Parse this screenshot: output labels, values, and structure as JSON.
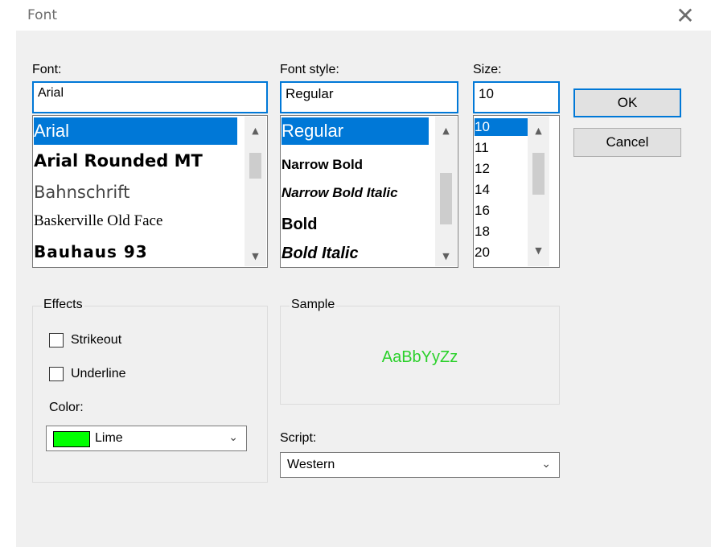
{
  "window": {
    "title": "Font",
    "close_glyph": "✕"
  },
  "font": {
    "label": "Font:",
    "value": "Arial",
    "items": [
      "Arial",
      "Arial Rounded MT",
      "Bahnschrift",
      "Baskerville Old Face",
      "Bauhaus 93"
    ]
  },
  "style": {
    "label": "Font style:",
    "value": "Regular",
    "items": [
      "Regular",
      "Narrow Bold",
      "Narrow Bold Italic",
      "Bold",
      "Bold Italic"
    ]
  },
  "size": {
    "label": "Size:",
    "value": "10",
    "items": [
      "10",
      "11",
      "12",
      "14",
      "16",
      "18",
      "20"
    ]
  },
  "buttons": {
    "ok": "OK",
    "cancel": "Cancel"
  },
  "effects": {
    "legend": "Effects",
    "strikeout": "Strikeout",
    "underline": "Underline",
    "strikeout_checked": false,
    "underline_checked": false,
    "color_label": "Color:",
    "color_value": "Lime",
    "color_hex": "#00ff00"
  },
  "sample": {
    "legend": "Sample",
    "text": "AaBbYyZz",
    "color": "#2bd12b"
  },
  "script": {
    "label": "Script:",
    "value": "Western"
  },
  "icons": {
    "scroll_up": "▲",
    "scroll_down": "▼",
    "dropdown": "chevron-down-icon",
    "close": "close-icon"
  }
}
